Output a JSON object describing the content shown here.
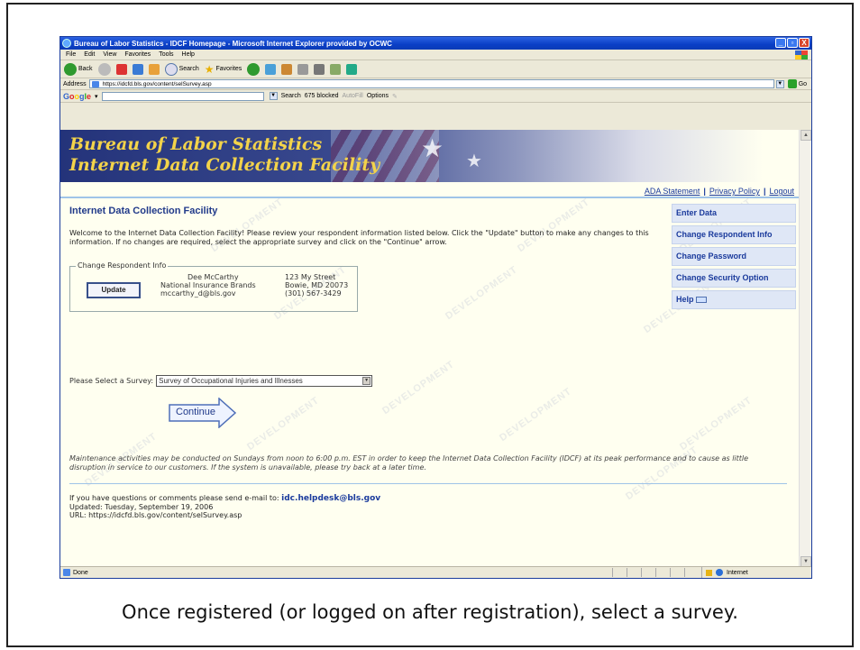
{
  "window": {
    "title": "Bureau of Labor Statistics - IDCF Homepage - Microsoft Internet Explorer provided by OCWC",
    "buttons": [
      "_",
      "▫",
      "X"
    ]
  },
  "menu": [
    "File",
    "Edit",
    "View",
    "Favorites",
    "Tools",
    "Help"
  ],
  "toolbar": {
    "back": "Back",
    "search": "Search",
    "favorites": "Favorites"
  },
  "address": {
    "label": "Address",
    "url": "https://idcfd.bls.gov/content/selSurvey.asp",
    "go": "Go"
  },
  "googlebar": {
    "logo": [
      "G",
      "o",
      "o",
      "g",
      "l",
      "e"
    ],
    "search": "Search",
    "blocked": "675 blocked",
    "autofill": "AutoFill",
    "options": "Options"
  },
  "banner": {
    "line1": "Bureau of Labor Statistics",
    "line2": "Internet Data Collection Facility"
  },
  "toplinks": [
    "ADA Statement",
    "Privacy Policy",
    "Logout"
  ],
  "watermark": "DEVELOPMENT",
  "page": {
    "title": "Internet Data Collection Facility",
    "welcome": "Welcome to the Internet Data Collection Facility! Please review your respondent information listed below. Click the \"Update\" button to make any changes to this information. If no changes are required, select the appropriate survey and click on the \"Continue\" arrow."
  },
  "respondent": {
    "legend": "Change Respondent Info",
    "update_label": "Update",
    "name": "Dee McCarthy",
    "company": "National Insurance Brands",
    "email": "mccarthy_d@bls.gov",
    "street": "123 My Street",
    "city": "Bowie, MD  20073",
    "phone": "(301) 567-3429"
  },
  "survey": {
    "label": "Please Select a Survey:",
    "selected": "Survey of Occupational Injuries and Illnesses",
    "continue_label": "Continue"
  },
  "sidenav": [
    "Enter Data",
    "Change Respondent Info",
    "Change Password",
    "Change Security Option",
    "Help"
  ],
  "maintenance": "Maintenance activities may be conducted on Sundays from noon to 6:00 p.m. EST in order to keep the Internet Data Collection Facility (IDCF) at its peak performance and to cause as little disruption in service to our customers. If the system is unavailable, please try back at a later time.",
  "footer": {
    "contact_prefix": "If you have questions or comments please send e-mail to:",
    "contact_email": "idc.helpdesk@bls.gov",
    "updated": "Updated: Tuesday, September 19, 2006",
    "url": "URL: https://idcfd.bls.gov/content/selSurvey.asp"
  },
  "status": {
    "text": "Done",
    "zone": "Internet"
  },
  "caption": "Once registered (or logged on after registration), select a survey."
}
